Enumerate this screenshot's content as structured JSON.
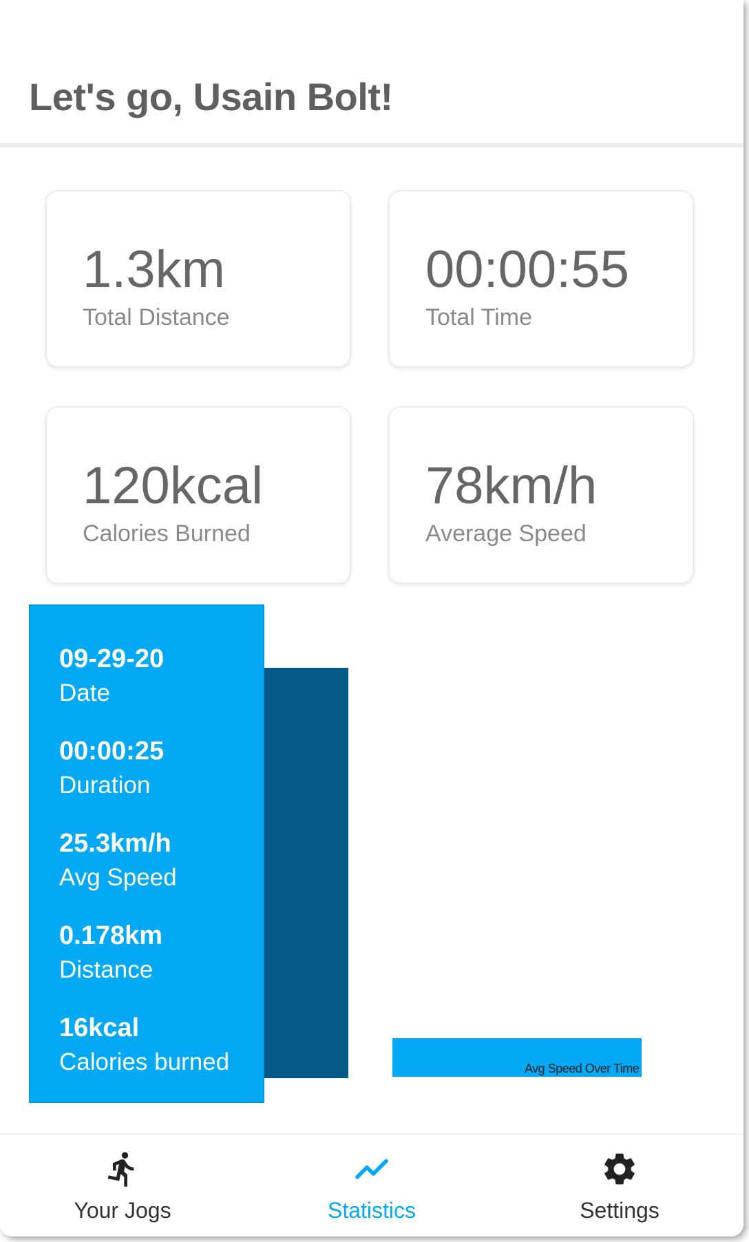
{
  "header": {
    "title": "Let's go, Usain Bolt!"
  },
  "stats": [
    {
      "value": "1.3km",
      "label": "Total Distance"
    },
    {
      "value": "00:00:55",
      "label": "Total Time"
    },
    {
      "value": "120kcal",
      "label": "Calories Burned"
    },
    {
      "value": "78km/h",
      "label": "Average Speed"
    }
  ],
  "chart": {
    "legend": "Avg Speed Over Time",
    "tooltip": [
      {
        "value": "09-29-20",
        "label": "Date"
      },
      {
        "value": "00:00:25",
        "label": "Duration"
      },
      {
        "value": "25.3km/h",
        "label": "Avg Speed"
      },
      {
        "value": "0.178km",
        "label": "Distance"
      },
      {
        "value": "16kcal",
        "label": "Calories burned"
      }
    ]
  },
  "nav": {
    "items": [
      {
        "label": "Your Jogs",
        "icon": "runner-icon"
      },
      {
        "label": "Statistics",
        "icon": "trending-icon",
        "active": true
      },
      {
        "label": "Settings",
        "icon": "gear-icon"
      }
    ]
  },
  "colors": {
    "accent": "#03a9f4",
    "dark_bar": "#035a86",
    "text_primary": "#666666"
  }
}
